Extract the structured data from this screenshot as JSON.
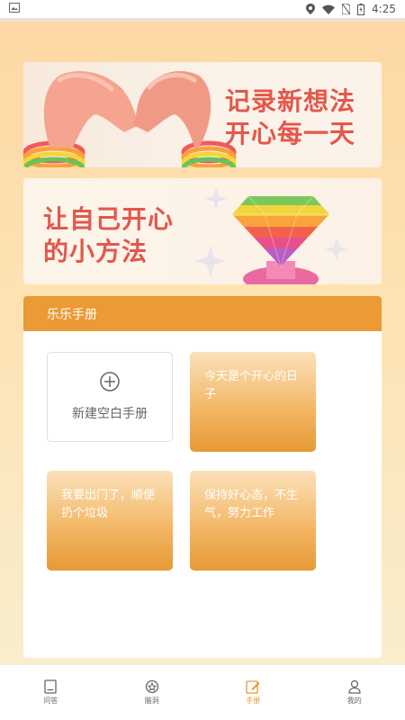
{
  "status_bar": {
    "time": "4:25"
  },
  "banners": [
    {
      "line1": "记录新想法",
      "line2": "开心每一天"
    },
    {
      "line1": "让自己开心",
      "line2": "的小方法"
    }
  ],
  "card": {
    "title": "乐乐手册",
    "new_tile_label": "新建空白手册",
    "notes": [
      "今天是个开心的日子",
      "我要出门了，顺便扔个垃圾",
      "保持好心态，不生气，努力工作"
    ]
  },
  "nav": {
    "items": [
      {
        "label": "问答",
        "icon": "book-icon"
      },
      {
        "label": "脑洞",
        "icon": "idea-icon"
      },
      {
        "label": "手册",
        "icon": "edit-icon"
      },
      {
        "label": "我的",
        "icon": "user-icon"
      }
    ],
    "active": "手册"
  },
  "colors": {
    "accent": "#eb9a36",
    "banner_text": "#e4574b"
  }
}
